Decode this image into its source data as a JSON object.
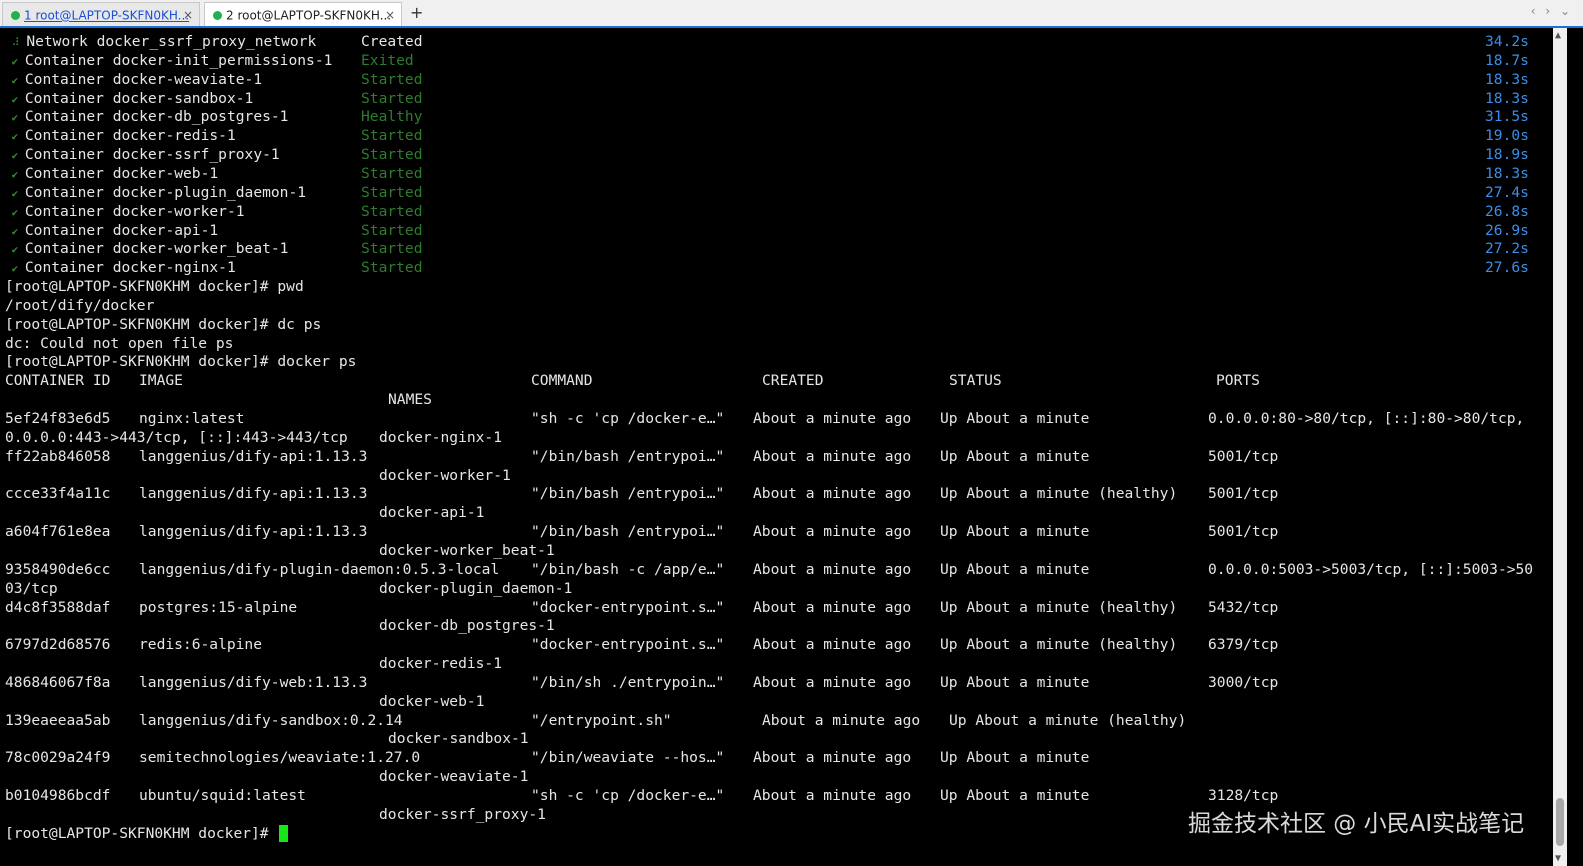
{
  "tabs": [
    {
      "label": "1 root@LAPTOP-SKFN0KH...",
      "active": true
    },
    {
      "label": "2 root@LAPTOP-SKFN0KH...",
      "active": false
    }
  ],
  "tab_close_glyph": "×",
  "new_tab_glyph": "+",
  "nav_glyphs": "‹ › ⌄",
  "compose": [
    {
      "mark": "⠼",
      "text": "Network docker_ssrf_proxy_network",
      "status": "Created",
      "time": "34.2s"
    },
    {
      "mark": "✔",
      "text": "Container docker-init_permissions-1",
      "status": "Exited",
      "time": "18.7s"
    },
    {
      "mark": "✔",
      "text": "Container docker-weaviate-1",
      "status": "Started",
      "time": "18.3s"
    },
    {
      "mark": "✔",
      "text": "Container docker-sandbox-1",
      "status": "Started",
      "time": "18.3s"
    },
    {
      "mark": "✔",
      "text": "Container docker-db_postgres-1",
      "status": "Healthy",
      "time": "31.5s"
    },
    {
      "mark": "✔",
      "text": "Container docker-redis-1",
      "status": "Started",
      "time": "19.0s"
    },
    {
      "mark": "✔",
      "text": "Container docker-ssrf_proxy-1",
      "status": "Started",
      "time": "18.9s"
    },
    {
      "mark": "✔",
      "text": "Container docker-web-1",
      "status": "Started",
      "time": "18.3s"
    },
    {
      "mark": "✔",
      "text": "Container docker-plugin_daemon-1",
      "status": "Started",
      "time": "27.4s"
    },
    {
      "mark": "✔",
      "text": "Container docker-worker-1",
      "status": "Started",
      "time": "26.8s"
    },
    {
      "mark": "✔",
      "text": "Container docker-api-1",
      "status": "Started",
      "time": "26.9s"
    },
    {
      "mark": "✔",
      "text": "Container docker-worker_beat-1",
      "status": "Started",
      "time": "27.2s"
    },
    {
      "mark": "✔",
      "text": "Container docker-nginx-1",
      "status": "Started",
      "time": "27.6s"
    }
  ],
  "shell": [
    "[root@LAPTOP-SKFN0KHM docker]# pwd",
    "/root/dify/docker",
    "[root@LAPTOP-SKFN0KHM docker]# dc ps",
    "dc: Could not open file ps",
    "[root@LAPTOP-SKFN0KHM docker]# docker ps"
  ],
  "headers": {
    "id": "CONTAINER ID",
    "image": "IMAGE",
    "command": "COMMAND",
    "created": "CREATED",
    "status": "STATUS",
    "ports": "PORTS",
    "names": "NAMES"
  },
  "rows": [
    {
      "id": "5ef24f83e6d5",
      "image": "nginx:latest",
      "command": "\"sh -c 'cp /docker-e…\"",
      "created": "About a minute ago",
      "status": "Up About a minute",
      "ports": "0.0.0.0:80->80/tcp, [::]:80->80/tcp,",
      "wrap": "0.0.0.0:443->443/tcp, [::]:443->443/tcp",
      "name": "docker-nginx-1"
    },
    {
      "id": "ff22ab846058",
      "image": "langgenius/dify-api:1.13.3",
      "command": "\"/bin/bash /entrypoi…\"",
      "created": "About a minute ago",
      "status": "Up About a minute",
      "ports": "5001/tcp",
      "wrap": "",
      "name": "docker-worker-1"
    },
    {
      "id": "ccce33f4a11c",
      "image": "langgenius/dify-api:1.13.3",
      "command": "\"/bin/bash /entrypoi…\"",
      "created": "About a minute ago",
      "status": "Up About a minute (healthy)",
      "ports": "5001/tcp",
      "wrap": "",
      "name": "docker-api-1"
    },
    {
      "id": "a604f761e8ea",
      "image": "langgenius/dify-api:1.13.3",
      "command": "\"/bin/bash /entrypoi…\"",
      "created": "About a minute ago",
      "status": "Up About a minute",
      "ports": "5001/tcp",
      "wrap": "",
      "name": "docker-worker_beat-1"
    },
    {
      "id": "9358490de6cc",
      "image": "langgenius/dify-plugin-daemon:0.5.3-local",
      "command": "\"/bin/bash -c /app/e…\"",
      "created": "About a minute ago",
      "status": "Up About a minute",
      "ports": "0.0.0.0:5003->5003/tcp, [::]:5003->50",
      "wrap": "03/tcp",
      "name": "docker-plugin_daemon-1"
    },
    {
      "id": "d4c8f3588daf",
      "image": "postgres:15-alpine",
      "command": "\"docker-entrypoint.s…\"",
      "created": "About a minute ago",
      "status": "Up About a minute (healthy)",
      "ports": "5432/tcp",
      "wrap": "",
      "name": "docker-db_postgres-1"
    },
    {
      "id": "6797d2d68576",
      "image": "redis:6-alpine",
      "command": "\"docker-entrypoint.s…\"",
      "created": "About a minute ago",
      "status": "Up About a minute (healthy)",
      "ports": "6379/tcp",
      "wrap": "",
      "name": "docker-redis-1"
    },
    {
      "id": "486846067f8a",
      "image": "langgenius/dify-web:1.13.3",
      "command": "\"/bin/sh ./entrypoin…\"",
      "created": "About a minute ago",
      "status": "Up About a minute",
      "ports": "3000/tcp",
      "wrap": "",
      "name": "docker-web-1"
    },
    {
      "id": "139eaeeaa5ab",
      "image": "langgenius/dify-sandbox:0.2.14",
      "command": "\"/entrypoint.sh\"",
      "created": "About a minute ago",
      "status": "Up About a minute (healthy)",
      "ports": "",
      "wrap": "",
      "name": "docker-sandbox-1"
    },
    {
      "id": "78c0029a24f9",
      "image": "semitechnologies/weaviate:1.27.0",
      "command": "\"/bin/weaviate --hos…\"",
      "created": "About a minute ago",
      "status": "Up About a minute",
      "ports": "",
      "wrap": "",
      "name": "docker-weaviate-1"
    },
    {
      "id": "b0104986bcdf",
      "image": "ubuntu/squid:latest",
      "command": "\"sh -c 'cp /docker-e…\"",
      "created": "About a minute ago",
      "status": "Up About a minute",
      "ports": "3128/tcp",
      "wrap": "",
      "name": "docker-ssrf_proxy-1"
    }
  ],
  "final_prompt": "[root@LAPTOP-SKFN0KHM docker]# ",
  "watermark": "掘金技术社区 @ 小民AI实战笔记",
  "colors": {
    "time": "#3b8ee8",
    "status_ok": "#2d7d2d",
    "cursor": "#19e619",
    "tab_accent": "#1e70d8"
  }
}
